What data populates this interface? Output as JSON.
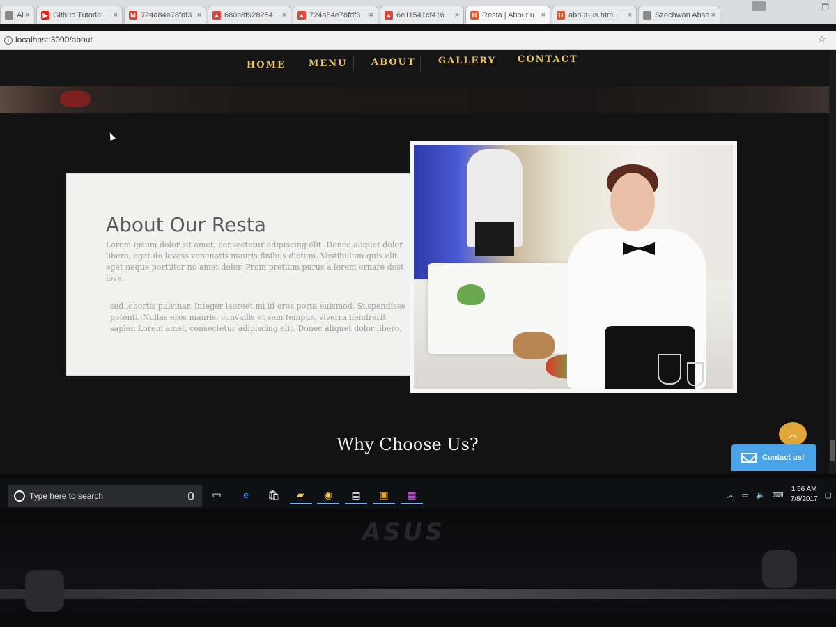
{
  "browser": {
    "tabs": [
      {
        "title": "Abso",
        "icon": "page-icon",
        "color": "#888888"
      },
      {
        "title": "Github Tutorial",
        "icon": "youtube-icon",
        "color": "#e62117"
      },
      {
        "title": "724a84e78fdf3",
        "icon": "gmail-icon",
        "color": "#d44638"
      },
      {
        "title": "680c8f928254",
        "icon": "image-icon",
        "color": "#e0453a"
      },
      {
        "title": "724a84e78fdf3",
        "icon": "image-icon",
        "color": "#e0453a"
      },
      {
        "title": "6e11541cf416",
        "icon": "image-icon",
        "color": "#e0453a"
      },
      {
        "title": "Resta | About u",
        "icon": "html-icon",
        "color": "#e05a2a"
      },
      {
        "title": "about-us.html",
        "icon": "html-icon",
        "color": "#e05a2a"
      },
      {
        "title": "Szechwan Abso",
        "icon": "page-icon",
        "color": "#888888"
      }
    ],
    "url": "localhost:3000/about"
  },
  "site": {
    "nav": [
      "HOME",
      "MENU",
      "ABOUT",
      "GALLERY",
      "CONTACT"
    ],
    "about": {
      "title": "About Our Resta",
      "paragraph1": "Lorem ipsum dolor sit amet, consectetur adipiscing elit. Donec aliquet dolor libero, eget do lovess venenatis mauris finibus dictum. Vestibulum quis elit eget neque porttitor no amet dolor. Proin pretium purus a lorem ornare dost love.",
      "paragraph2": "sed lobortis pulvinar. Integer laoreet mi id eros porta euismod. Suspendisse potenti. Nullas eros mauris, convallis et sem tempus, viverra hendrerit sapien Lorem amet, consectetur adipiscing elit. Donec aliquet dolor libero."
    },
    "why_title": "Why Choose Us?",
    "contact_button": "Contact us!",
    "accent_color": "#e9c46a"
  },
  "taskbar": {
    "search_placeholder": "Type here to search",
    "time": "1:56 AM",
    "date": "7/8/2017"
  },
  "bezel": {
    "brand": "ASUS"
  }
}
